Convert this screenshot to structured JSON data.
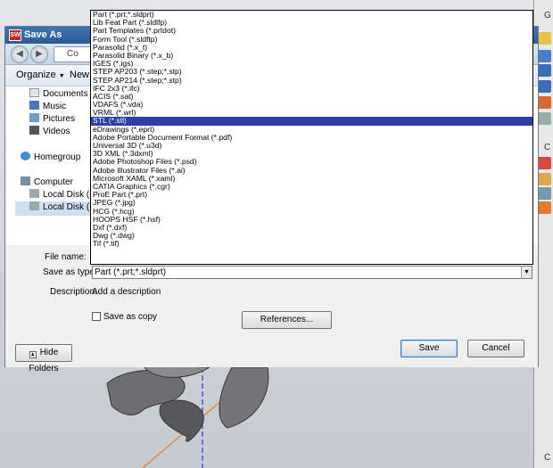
{
  "dialog": {
    "title": "Save As",
    "address_text": "Co",
    "toolbar": {
      "organize": "Organize",
      "new_folder": "New fo"
    },
    "sidebar": [
      {
        "label": "Documents",
        "icon": "documents-icon",
        "indent": 1
      },
      {
        "label": "Music",
        "icon": "music-icon",
        "indent": 1
      },
      {
        "label": "Pictures",
        "icon": "pictures-icon",
        "indent": 1
      },
      {
        "label": "Videos",
        "icon": "videos-icon",
        "indent": 1
      },
      {
        "label": "Homegroup",
        "icon": "homegroup-icon",
        "indent": 0
      },
      {
        "label": "Computer",
        "icon": "computer-icon",
        "indent": 0
      },
      {
        "label": "Local Disk (C:)",
        "icon": "disk-icon",
        "indent": 1
      },
      {
        "label": "Local Disk (D:)",
        "icon": "disk-icon",
        "indent": 1,
        "selected": true
      }
    ],
    "file_name_label": "File name:",
    "save_type_label": "Save as type:",
    "save_type_value": "Part (*.prt;*.sldprt)",
    "description_label": "Description:",
    "description_value": "Add a description",
    "save_as_copy_label": "Save as copy",
    "references_button": "References...",
    "hide_folders_button": "Hide Folders",
    "save_button": "Save",
    "cancel_button": "Cancel"
  },
  "file_types": [
    "Part (*.prt;*.sldprt)",
    "Lib Feat Part (*.sldlfp)",
    "Part Templates (*.prtdot)",
    "Form Tool (*.sldftp)",
    "Parasolid (*.x_t)",
    "Parasolid Binary (*.x_b)",
    "IGES (*.igs)",
    "STEP AP203 (*.step;*.stp)",
    "STEP AP214 (*.step;*.stp)",
    "IFC 2x3 (*.ifc)",
    "ACIS (*.sat)",
    "VDAFS (*.vda)",
    "VRML (*.wrl)",
    "STL (*.stl)",
    "eDrawings (*.eprt)",
    "Adobe Portable Document Format (*.pdf)",
    "Universal 3D (*.u3d)",
    "3D XML (*.3dxml)",
    "Adobe Photoshop Files (*.psd)",
    "Adobe Illustrator Files (*.ai)",
    "Microsoft XAML (*.xaml)",
    "CATIA Graphics (*.cgr)",
    "ProE Part (*.prt)",
    "JPEG (*.jpg)",
    "HCG (*.hcg)",
    "HOOPS HSF (*.hsf)",
    "Dxf (*.dxf)",
    "Dwg (*.dwg)",
    "Tif (*.tif)"
  ],
  "selected_file_type": "STL (*.stl)",
  "right_strip_letters": [
    "G",
    "C",
    "C"
  ]
}
